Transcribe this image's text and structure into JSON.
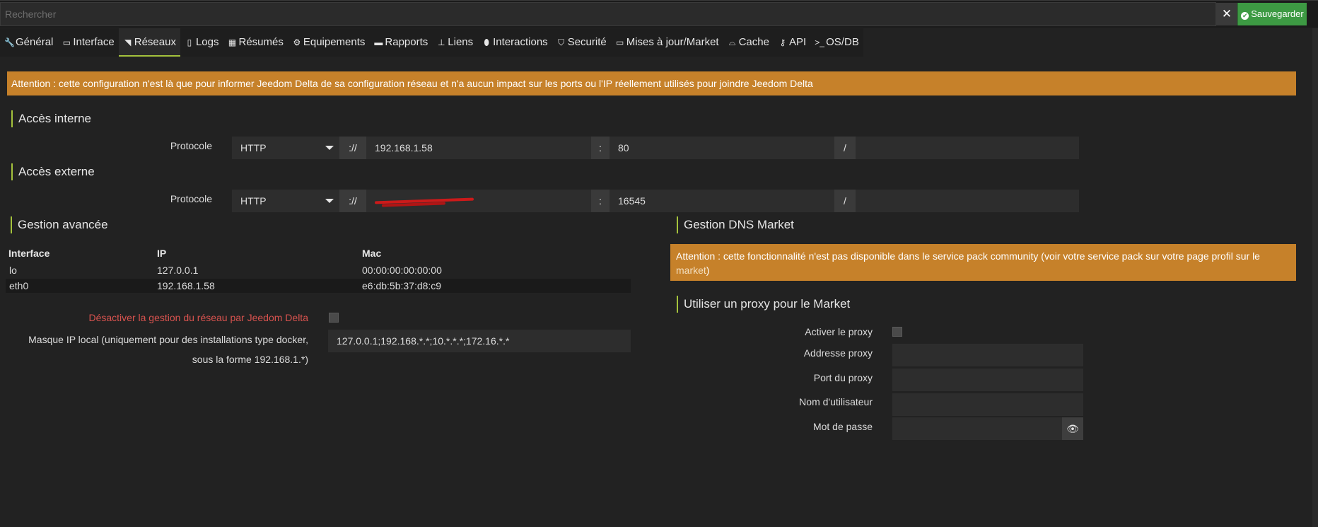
{
  "search": {
    "placeholder": "Rechercher"
  },
  "toolbar": {
    "close_label": "✕",
    "save_label": "Sauvegarder"
  },
  "tabs": [
    {
      "label": "Général",
      "icon": "wrench-icon",
      "active": false
    },
    {
      "label": "Interface",
      "icon": "laptop-icon",
      "active": false
    },
    {
      "label": "Réseaux",
      "icon": "rss-icon",
      "active": true
    },
    {
      "label": "Logs",
      "icon": "file-icon",
      "active": false
    },
    {
      "label": "Résumés",
      "icon": "table-icon",
      "active": false
    },
    {
      "label": "Equipements",
      "icon": "gears-icon",
      "active": false
    },
    {
      "label": "Rapports",
      "icon": "report-icon",
      "active": false
    },
    {
      "label": "Liens",
      "icon": "sitemap-icon",
      "active": false
    },
    {
      "label": "Interactions",
      "icon": "microphone-icon",
      "active": false
    },
    {
      "label": "Securité",
      "icon": "shield-icon",
      "active": false
    },
    {
      "label": "Mises à jour/Market",
      "icon": "credit-card-icon",
      "active": false
    },
    {
      "label": "Cache",
      "icon": "hdd-icon",
      "active": false
    },
    {
      "label": "API",
      "icon": "key-icon",
      "active": false
    },
    {
      "label": "OS/DB",
      "icon": "terminal-icon",
      "active": false
    }
  ],
  "alert_main": "Attention : cette configuration n'est là que pour informer Jeedom Delta de sa configuration réseau et n'a aucun impact sur les ports ou l'IP réellement utilisés pour joindre Jeedom Delta",
  "internal": {
    "title": "Accès interne",
    "protocol_label": "Protocole",
    "protocol": "HTTP",
    "scheme_sep": "://",
    "host": "192.168.1.58",
    "port_sep": ":",
    "port": "80",
    "path_sep": "/",
    "path": ""
  },
  "external": {
    "title": "Accès externe",
    "protocol_label": "Protocole",
    "protocol": "HTTP",
    "scheme_sep": "://",
    "host": "",
    "port_sep": ":",
    "port": "16545",
    "path_sep": "/",
    "path": ""
  },
  "advanced": {
    "title": "Gestion avancée",
    "columns": [
      "Interface",
      "IP",
      "Mac"
    ],
    "rows": [
      {
        "interface": "lo",
        "ip": "127.0.0.1",
        "mac": "00:00:00:00:00:00"
      },
      {
        "interface": "eth0",
        "ip": "192.168.1.58",
        "mac": "e6:db:5b:37:d8:c9"
      }
    ],
    "disable_label": "Désactiver la gestion du réseau par Jeedom Delta",
    "mask_label_line1": "Masque IP local (uniquement pour des installations type docker,",
    "mask_label_line2": "sous la forme 192.168.1.*)",
    "mask_value": "127.0.0.1;192.168.*.*;10.*.*.*;172.16.*.*"
  },
  "dns": {
    "title": "Gestion DNS Market",
    "alert_text": "Attention : cette fonctionnalité n'est pas disponible dans le service pack community (voir votre service pack sur votre page profil sur le ",
    "alert_link": "market",
    "alert_end": ")"
  },
  "proxy": {
    "title": "Utiliser un proxy pour le Market",
    "enable_label": "Activer le proxy",
    "address_label": "Addresse proxy",
    "port_label": "Port du proxy",
    "user_label": "Nom d'utilisateur",
    "password_label": "Mot de passe"
  },
  "colors": {
    "accent": "#a4c23c",
    "warning": "#c6812a",
    "save": "#3d9a43",
    "danger": "#d9534f"
  }
}
